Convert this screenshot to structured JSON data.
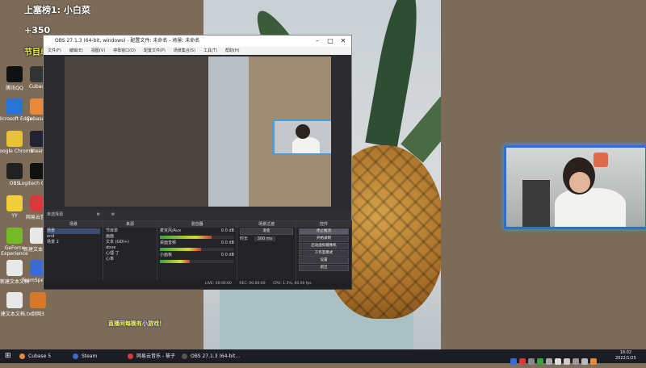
{
  "overlay": {
    "leaderboard": "上塞榜1: 小白菜",
    "score": "+350",
    "time_label": "节目单：10点30拼抽"
  },
  "desktop_icons": [
    {
      "label": "腾讯QQ",
      "color": "#111"
    },
    {
      "label": "Microsoft Edge",
      "color": "#2a74d6"
    },
    {
      "label": "Google Chrome",
      "color": "#e8c13a"
    },
    {
      "label": "OBS",
      "color": "#222"
    },
    {
      "label": "YY",
      "color": "#f2cf3a"
    },
    {
      "label": "GeForce Experience",
      "color": "#75b828"
    },
    {
      "label": "新建文本文档",
      "color": "#e8e8e8"
    },
    {
      "label": "新建文本文档.txt",
      "color": "#e8e8e8"
    }
  ],
  "desktop_icons_col2": [
    {
      "label": "Cubase",
      "color": "#333"
    },
    {
      "label": "Cubase 5",
      "color": "#e8893a"
    },
    {
      "label": "Steam",
      "color": "#223"
    },
    {
      "label": "Logitech G HUB",
      "color": "#111"
    },
    {
      "label": "网易云音乐",
      "color": "#d63a3a"
    },
    {
      "label": "新建文本文档",
      "color": "#e8e8e8"
    },
    {
      "label": "TeamSpeak 3",
      "color": "#3a6ad6"
    },
    {
      "label": "剑网3",
      "color": "#d67a2a"
    }
  ],
  "obs": {
    "title": "OBS 27.1.3 (64-bit, windows) - 配置文件: 未命名 - 场景: 未命名",
    "menu": [
      "文件(F)",
      "编辑(E)",
      "视图(V)",
      "停靠窗口(D)",
      "配置文件(P)",
      "场景集合(S)",
      "工具(T)",
      "帮助(H)"
    ],
    "source_dock": "未选择源",
    "panels": {
      "scenes": {
        "title": "场景",
        "items": [
          "场景",
          "end",
          "场景 2"
        ]
      },
      "sources": {
        "title": "来源",
        "items": [
          "节目单",
          "画面",
          "文本 (GDI+)",
          "dove",
          "心理·丁",
          "心率"
        ]
      },
      "mixer": {
        "title": "混音器",
        "channels": [
          {
            "name": "麦克风/Aux",
            "value": "0.0 dB",
            "level": 0.7
          },
          {
            "name": "桌面音频",
            "value": "0.0 dB",
            "level": 0.55
          },
          {
            "name": "小画板",
            "value": "0.0 dB",
            "level": 0.4
          }
        ]
      },
      "transitions": {
        "title": "场景过渡",
        "type": "渐变",
        "duration_label": "时长",
        "duration": "300 ms"
      },
      "controls": {
        "title": "控件",
        "buttons": [
          "停止推流",
          "开始录制",
          "启动虚拟摄像机",
          "工作室模式",
          "设置",
          "退出"
        ]
      }
    },
    "status": {
      "live": "LIVE: 00:00:00",
      "rec": "REC: 00:00:00",
      "cpu": "CPU: 1.5%, 60.00 fps"
    }
  },
  "banner": "直播间每晚有小游戏！",
  "taskbar": {
    "items": [
      {
        "label": "Cubase 5",
        "color": "#e8893a"
      },
      {
        "label": "Steam",
        "color": "#3a6ad6"
      },
      {
        "label": "网易云音乐 - 筱子",
        "color": "#d63a3a"
      },
      {
        "label": "OBS 27.1.3 (64-bit...",
        "color": "#555"
      }
    ],
    "clock_time": "18:02",
    "clock_date": "2022/1/25"
  },
  "colors": {
    "accent": "#3aa1e8",
    "obs_bg": "#2b2b30",
    "overlay_text": "#f4f83f"
  }
}
